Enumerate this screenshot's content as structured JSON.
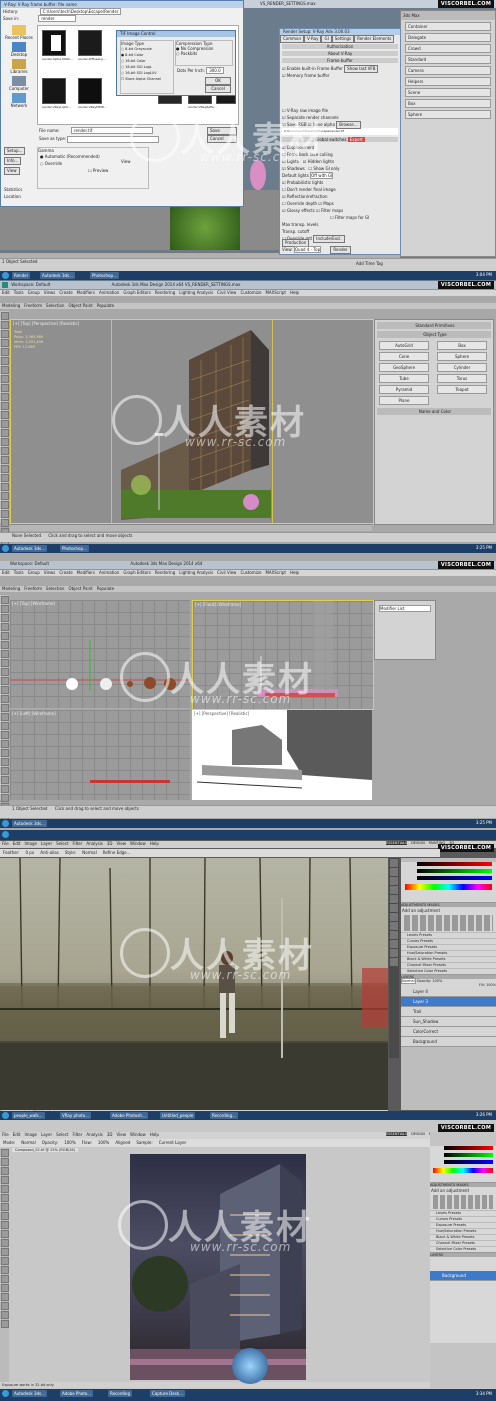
{
  "brand": "VISCORBEL.COM",
  "watermark": {
    "cn": "人人素材",
    "url": "www.rr-sc.com"
  },
  "panel1": {
    "file_dialog": {
      "title": "V-Ray: V-Ray frame buffer: file name",
      "save_in_label": "Save in:",
      "save_in": "render",
      "recent": "Recent Places",
      "desktop": "Desktop",
      "libraries": "Libraries",
      "computer": "Computer",
      "network": "Network",
      "history_label": "History:",
      "history": "C:\\Users\\tech\\Desktop\\Escape\\Render",
      "files": [
        "render.Alpha.0000…",
        "render.DiffuseLg…",
        "render.VRayLight…",
        "render.VRayMtlID…",
        "render.VRayRefle…"
      ],
      "filename_label": "File name:",
      "filename": "render.tif",
      "save_as_label": "Save as type:",
      "save_btn": "Save",
      "cancel_btn": "Cancel",
      "setup_btn": "Setup...",
      "info_btn": "Info...",
      "view_btn": "View",
      "gamma_label": "Gamma",
      "automatic": "Automatic (Recommended)",
      "override": "Override",
      "preview": "Preview",
      "stats_label": "Statistics",
      "location_label": "Location"
    },
    "tiff_dialog": {
      "title": "TIF Image Control",
      "image_type": "Image Type",
      "opts": [
        "8-bit Grayscale",
        "8-bit Color",
        "16-bit Color",
        "16-bit SGI LogL",
        "16-bit SGI LogLUV",
        "Store Alpha Channel"
      ],
      "compression": "Compression Type",
      "comp_opts": [
        "No Compression",
        "Packbits"
      ],
      "dpi_label": "Dots Per Inch:",
      "dpi": "300.0",
      "ok": "OK",
      "cancel": "Cancel"
    },
    "render_setup": {
      "title": "Render Setup: V-Ray Adv 3.00.03",
      "tabs": [
        "Common",
        "V-Ray",
        "GI",
        "Settings",
        "Render Elements"
      ],
      "authorization": "Authorization",
      "about": "About V-Ray",
      "frame_buffer": "Frame buffer",
      "enable_fb": "Enable built-in Frame Buffer",
      "memory_fb": "Memory frame buffer",
      "show_last": "Show last VFB",
      "vray_raw": "V-Ray raw image file",
      "separate": "Separate render channels",
      "save_rgb": "Save RGB",
      "save_alpha": "Save alpha",
      "browse": "Browse...",
      "path": "C:\\Users\\tech\\Desktop\\Escape\\render.tif",
      "global_switches": "Global switches",
      "expert": "Expert",
      "displacement": "Displacement",
      "force_back": "Force back face culling",
      "lights": "Lights",
      "hidden_lights": "Hidden lights",
      "shadows": "Shadows",
      "show_gi": "Show GI only",
      "default_lights": "Default lights",
      "off_gi": "Off with GI",
      "prob_lights": "Probabilistic lights",
      "dont_render": "Don't render final image",
      "reflection": "Reflection/refraction",
      "override_depth": "Override depth",
      "glossy": "Glossy effects",
      "maps": "Maps",
      "filter_maps": "Filter maps",
      "filter_gi": "Filter maps for GI",
      "max_transp": "Max transp. levels",
      "transp_cutoff": "Transp. cutoff",
      "override_mtl": "Override mtl",
      "include_excl": "Include/Excl.",
      "production": "Production",
      "preset": "Preset:",
      "view": "View:",
      "view_val": "Quad 4 - Top",
      "render_btn": "Render"
    },
    "max_side": {
      "title": "3ds Max",
      "items": [
        "Container",
        "Delegate",
        "Crowd",
        "Standard",
        "Camera",
        "Helpers",
        "Scene",
        "Box",
        "Sphere"
      ]
    },
    "taskbar": [
      "Render",
      "Autodesk 3ds...",
      "Photoshop..."
    ],
    "status": {
      "selected": "1 Object Selected",
      "hint": "Click or click-and-drag to select objects",
      "time": "3:04 PM",
      "date": "2/28/2014",
      "add_time": "Add Time Tag"
    },
    "tb_title": "VS_RENDER_SETTINGS.max"
  },
  "panel2": {
    "tb_title": "Autodesk 3ds Max Design 2014 x64  VS_RENDER_SETTINGS.max",
    "search": "Type a keyword or phrase",
    "menus": [
      "Edit",
      "Tools",
      "Group",
      "Views",
      "Create",
      "Modifiers",
      "Animation",
      "Graph Editors",
      "Rendering",
      "Lighting Analysis",
      "Civil View",
      "Customize",
      "MAXScript",
      "Help"
    ],
    "ribbon": [
      "Modeling",
      "Freeform",
      "Selection",
      "Object Paint",
      "Populate"
    ],
    "vp_label": "[+] [Top] [Perspective] [Realistic]",
    "stats": [
      "Total",
      "Polys: 3,365,989",
      "Verts: 1,931,406",
      "FPS: 12.069"
    ],
    "side": [
      "Standard Primitives",
      "Object Type",
      "AutoGrid",
      "Box",
      "Cone",
      "Sphere",
      "GeoSphere",
      "Cylinder",
      "Tube",
      "Torus",
      "Pyramid",
      "Teapot",
      "Plane",
      "Name and Color"
    ],
    "status": {
      "selected": "None Selected",
      "hint": "Click and drag to select and move objects",
      "time": "3:25 PM"
    },
    "workspace": "Workspace: Default"
  },
  "panel3": {
    "tb_title": "Autodesk 3ds Max Design 2014 x64",
    "menus": [
      "Edit",
      "Tools",
      "Group",
      "Views",
      "Create",
      "Modifiers",
      "Animation",
      "Graph Editors",
      "Rendering",
      "Lighting Analysis",
      "Civil View",
      "Customize",
      "MAXScript",
      "Help"
    ],
    "ribbon": [
      "Modeling",
      "Freeform",
      "Selection",
      "Object Paint",
      "Populate"
    ],
    "vp": [
      "[+] [Top] [Wireframe]",
      "[+] [Front] [Wireframe]",
      "[+] [Left] [Wireframe]",
      "[+] [Perspective] [Realistic]"
    ],
    "side": [
      "Modifier List"
    ],
    "status": {
      "selected": "1 Object Selected",
      "hint": "Click and drag to select and move objects",
      "time": "3:25 PM"
    },
    "workspace": "Workspace: Default"
  },
  "panel4": {
    "menus": [
      "File",
      "Edit",
      "Image",
      "Layer",
      "Select",
      "Filter",
      "Analysis",
      "3D",
      "View",
      "Window",
      "Help"
    ],
    "options": [
      "Feather:",
      "0 px",
      "Anti-alias",
      "Style:",
      "Normal",
      "Refine Edge..."
    ],
    "workspace": [
      "ESSENTIALS",
      "DESIGN",
      "PAINTING",
      "3D"
    ],
    "adjustments_title": "ADJUSTMENTS",
    "masks": "MASKS",
    "add_adj": "Add an adjustment",
    "presets": [
      "Levels Presets",
      "Curves Presets",
      "Exposure Presets",
      "Hue/Saturation Presets",
      "Black & White Presets",
      "Channel Mixer Presets",
      "Selective Color Presets"
    ],
    "layers_title": "LAYERS",
    "blend": "Normal",
    "opacity": "Opacity: 100%",
    "fill": "Fill: 100%",
    "layers": [
      "Layer 4",
      "Layer 3",
      "Trail",
      "Sun_Shadow",
      "ColorCorrect",
      "Background"
    ],
    "selected_layer": 1,
    "status": "Exposure works in 32-bit only",
    "taskbar": [
      "people_walk...",
      "VRay photo...",
      "Adobe Photosh...",
      "Untitled_people",
      "Recording..."
    ],
    "time": "3:26 PM"
  },
  "panel5": {
    "menus": [
      "File",
      "Edit",
      "Image",
      "Layer",
      "Select",
      "Filter",
      "Analysis",
      "3D",
      "View",
      "Window",
      "Help"
    ],
    "options": [
      "Mode:",
      "Normal",
      "Opacity:",
      "100%",
      "Flow:",
      "100%",
      "Aligned",
      "Sample:",
      "Current Layer"
    ],
    "workspace": [
      "ESSENTIALS",
      "DESIGN",
      "PAINTING",
      "3D"
    ],
    "doc_tab": "Composed_02.tif @ 25% (RGB/16)",
    "adjustments_title": "ADJUSTMENTS",
    "masks": "MASKS",
    "add_adj": "Add an adjustment",
    "presets": [
      "Levels Presets",
      "Curves Presets",
      "Exposure Presets",
      "Hue/Saturation Presets",
      "Black & White Presets",
      "Channel Mixer Presets",
      "Selective Color Presets"
    ],
    "layers_title": "LAYERS",
    "layers": [
      "Background"
    ],
    "status": "Exposure works in 32-bit only",
    "taskbar": [
      "Autodesk 3ds...",
      "Adobe Photo...",
      "Recording",
      "Capture Desk..."
    ],
    "time": "3:34 PM"
  }
}
